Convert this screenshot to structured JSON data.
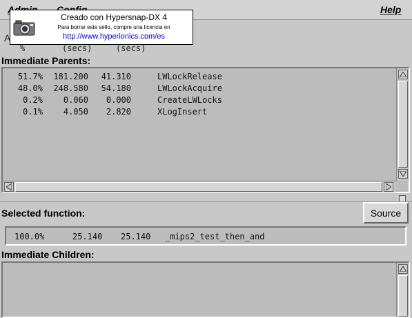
{
  "menubar": {
    "admin_label": "Admin",
    "config_label": "Config",
    "help_label": "Help"
  },
  "watermark": {
    "title": "Creado con Hypersnap-DX 4",
    "note": "Para borrar este sello, compre una licencia en",
    "url": "http://www.hyperionics.com/es"
  },
  "columns": {
    "col1_partial": "A",
    "col1_unit": "%",
    "col2_unit": "(secs)",
    "col3_unit": "(secs)"
  },
  "parents": {
    "label": "Immediate Parents:",
    "rows": [
      {
        "pct": "51.7%",
        "total": "181.200",
        "self": "41.310",
        "name": "LWLockRelease"
      },
      {
        "pct": "48.0%",
        "total": "248.580",
        "self": "54.180",
        "name": "LWLockAcquire"
      },
      {
        "pct": "0.2%",
        "total": "0.060",
        "self": "0.000",
        "name": "CreateLWLocks"
      },
      {
        "pct": "0.1%",
        "total": "4.050",
        "self": "2.820",
        "name": "XLogInsert"
      }
    ]
  },
  "selected": {
    "label": "Selected function:",
    "source_button": "Source",
    "row": {
      "pct": "100.0%",
      "total": "25.140",
      "self": "25.140",
      "name": "_mips2_test_then_and"
    }
  },
  "children": {
    "label": "Immediate Children:"
  },
  "colors": {
    "background": "#c8c8c8",
    "panel": "#bcbcbc",
    "url": "#0000cc"
  },
  "icons": [
    "camera-icon",
    "arrow-up-icon",
    "arrow-down-icon",
    "arrow-left-icon",
    "arrow-right-icon"
  ]
}
